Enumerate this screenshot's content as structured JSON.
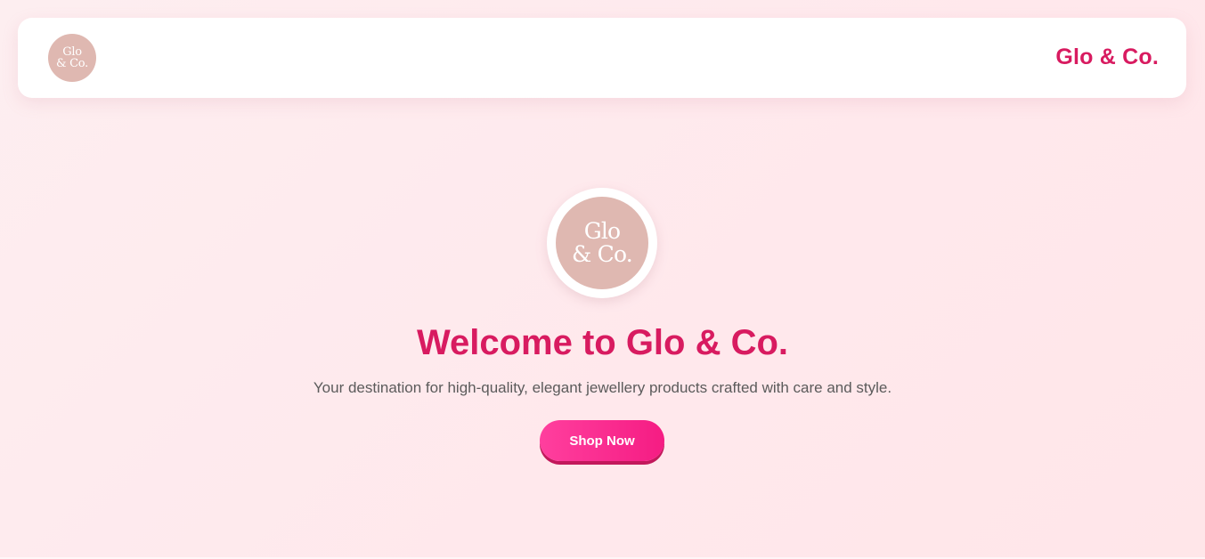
{
  "header": {
    "logo_line1": "Glo",
    "logo_line2": "& Co.",
    "brand": "Glo & Co."
  },
  "hero": {
    "logo_line1": "Glo",
    "logo_line2": "& Co.",
    "title": "Welcome to Glo & Co.",
    "subtitle": "Your destination for high-quality, elegant jewellery products crafted with care and style.",
    "button_label": "Shop Now"
  },
  "colors": {
    "brand": "#d81b60",
    "logo_bg": "#dfb8b1",
    "button_start": "#ff3f9e",
    "button_end": "#f51c83"
  }
}
